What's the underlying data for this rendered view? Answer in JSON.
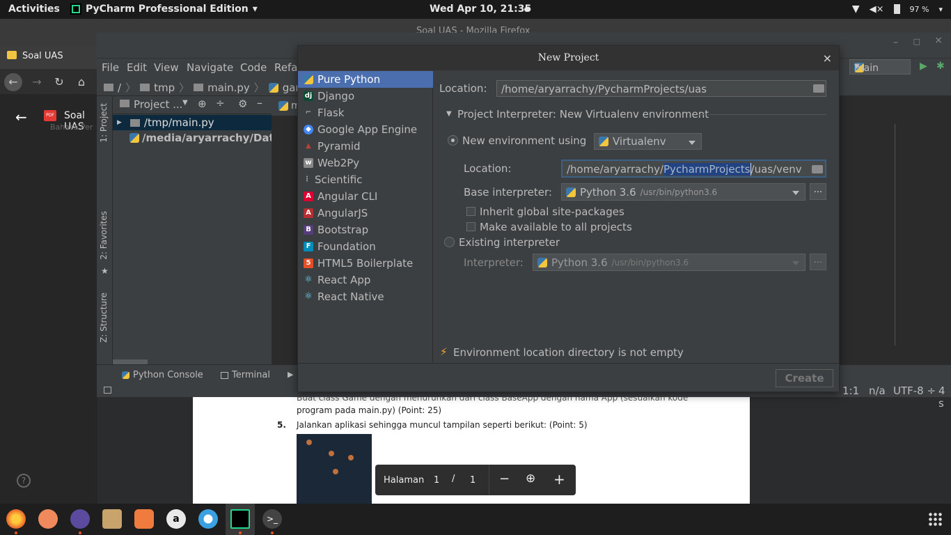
{
  "topbar": {
    "activities": "Activities",
    "app_name": "PyCharm Professional Edition",
    "app_menu_arrow": "▾",
    "clock": "Wed Apr 10, 21:35",
    "battery": "97 %"
  },
  "firefox": {
    "window_title": "Soal UAS - Mozilla Firefox",
    "tab_title": "Soal UAS",
    "pdf_header": "Soal UAS",
    "pdf_sub": "Bahasa Per",
    "doc_line1": "Buat class Game dengan menurunkan dari class BaseApp dengan nama App (sesuaikan kode",
    "doc_line2": "program pada main.py) (Point: 25)",
    "doc_item_num": "5.",
    "doc_item_text": "Jalankan aplikasi sehingga muncul tampilan seperti berikut: (Point: 5)",
    "toolbar": {
      "label": "Halaman",
      "page": "1",
      "sep": "/",
      "total": "1"
    }
  },
  "pycharm": {
    "menu": [
      "File",
      "Edit",
      "View",
      "Navigate",
      "Code",
      "Refa"
    ],
    "breadcrumbs": [
      "/",
      "tmp",
      "main.py",
      "game.py"
    ],
    "run_config": "main",
    "project_panel_title": "Project ...",
    "tree": [
      {
        "label": "/tmp/main.py"
      },
      {
        "label": "/media/aryarrachy/Dat"
      }
    ],
    "left_tabs": [
      "1: Project",
      "2: Favorites",
      "Z: Structure"
    ],
    "bottom_tabs": [
      "Python Console",
      "Terminal"
    ],
    "status": {
      "position": "1:1",
      "na": "n/a",
      "encoding": "UTF-8 ÷",
      "extra": "4 s"
    },
    "editor_tab": "m"
  },
  "dialog": {
    "title": "New Project",
    "close": "×",
    "project_types": [
      {
        "label": "Pure Python",
        "icon": "python-icon",
        "color": "#3b77a8"
      },
      {
        "label": "Django",
        "icon": "django-icon",
        "color": "#0c4b33"
      },
      {
        "label": "Flask",
        "icon": "flask-icon",
        "color": "#999999"
      },
      {
        "label": "Google App Engine",
        "icon": "gae-icon",
        "color": "#4285f4"
      },
      {
        "label": "Pyramid",
        "icon": "pyramid-icon",
        "color": "#b8433c"
      },
      {
        "label": "Web2Py",
        "icon": "web2py-icon",
        "color": "#888888"
      },
      {
        "label": "Scientific",
        "icon": "scientific-icon",
        "color": "#aaaaaa"
      },
      {
        "label": "Angular CLI",
        "icon": "angular-cli-icon",
        "color": "#dd0031"
      },
      {
        "label": "AngularJS",
        "icon": "angularjs-icon",
        "color": "#b52e31"
      },
      {
        "label": "Bootstrap",
        "icon": "bootstrap-icon",
        "color": "#563d7c"
      },
      {
        "label": "Foundation",
        "icon": "foundation-icon",
        "color": "#008cba"
      },
      {
        "label": "HTML5 Boilerplate",
        "icon": "html5-icon",
        "color": "#e34f26"
      },
      {
        "label": "React App",
        "icon": "react-icon",
        "color": "#61dafb"
      },
      {
        "label": "React Native",
        "icon": "react-native-icon",
        "color": "#61dafb"
      }
    ],
    "location_label": "Location:",
    "location_value": "/home/aryarrachy/PycharmProjects/uas",
    "interpreter_section": "Project Interpreter: New Virtualenv environment",
    "new_env_label": "New environment using",
    "env_tool": "Virtualenv",
    "venv_location_label": "Location:",
    "venv_location_pre": "/home/aryarrachy/",
    "venv_location_sel": "PycharmProjects",
    "venv_location_post": "/uas/venv",
    "base_interp_label": "Base interpreter:",
    "base_interp_name": "Python 3.6",
    "base_interp_path": "/usr/bin/python3.6",
    "inherit_label": "Inherit global site-packages",
    "make_available_label": "Make available to all projects",
    "existing_label": "Existing interpreter",
    "interpreter_label": "Interpreter:",
    "interp_name": "Python 3.6",
    "interp_path": "/usr/bin/python3.6",
    "browse": "...",
    "warning": "Environment location directory is not empty",
    "create": "Create"
  }
}
